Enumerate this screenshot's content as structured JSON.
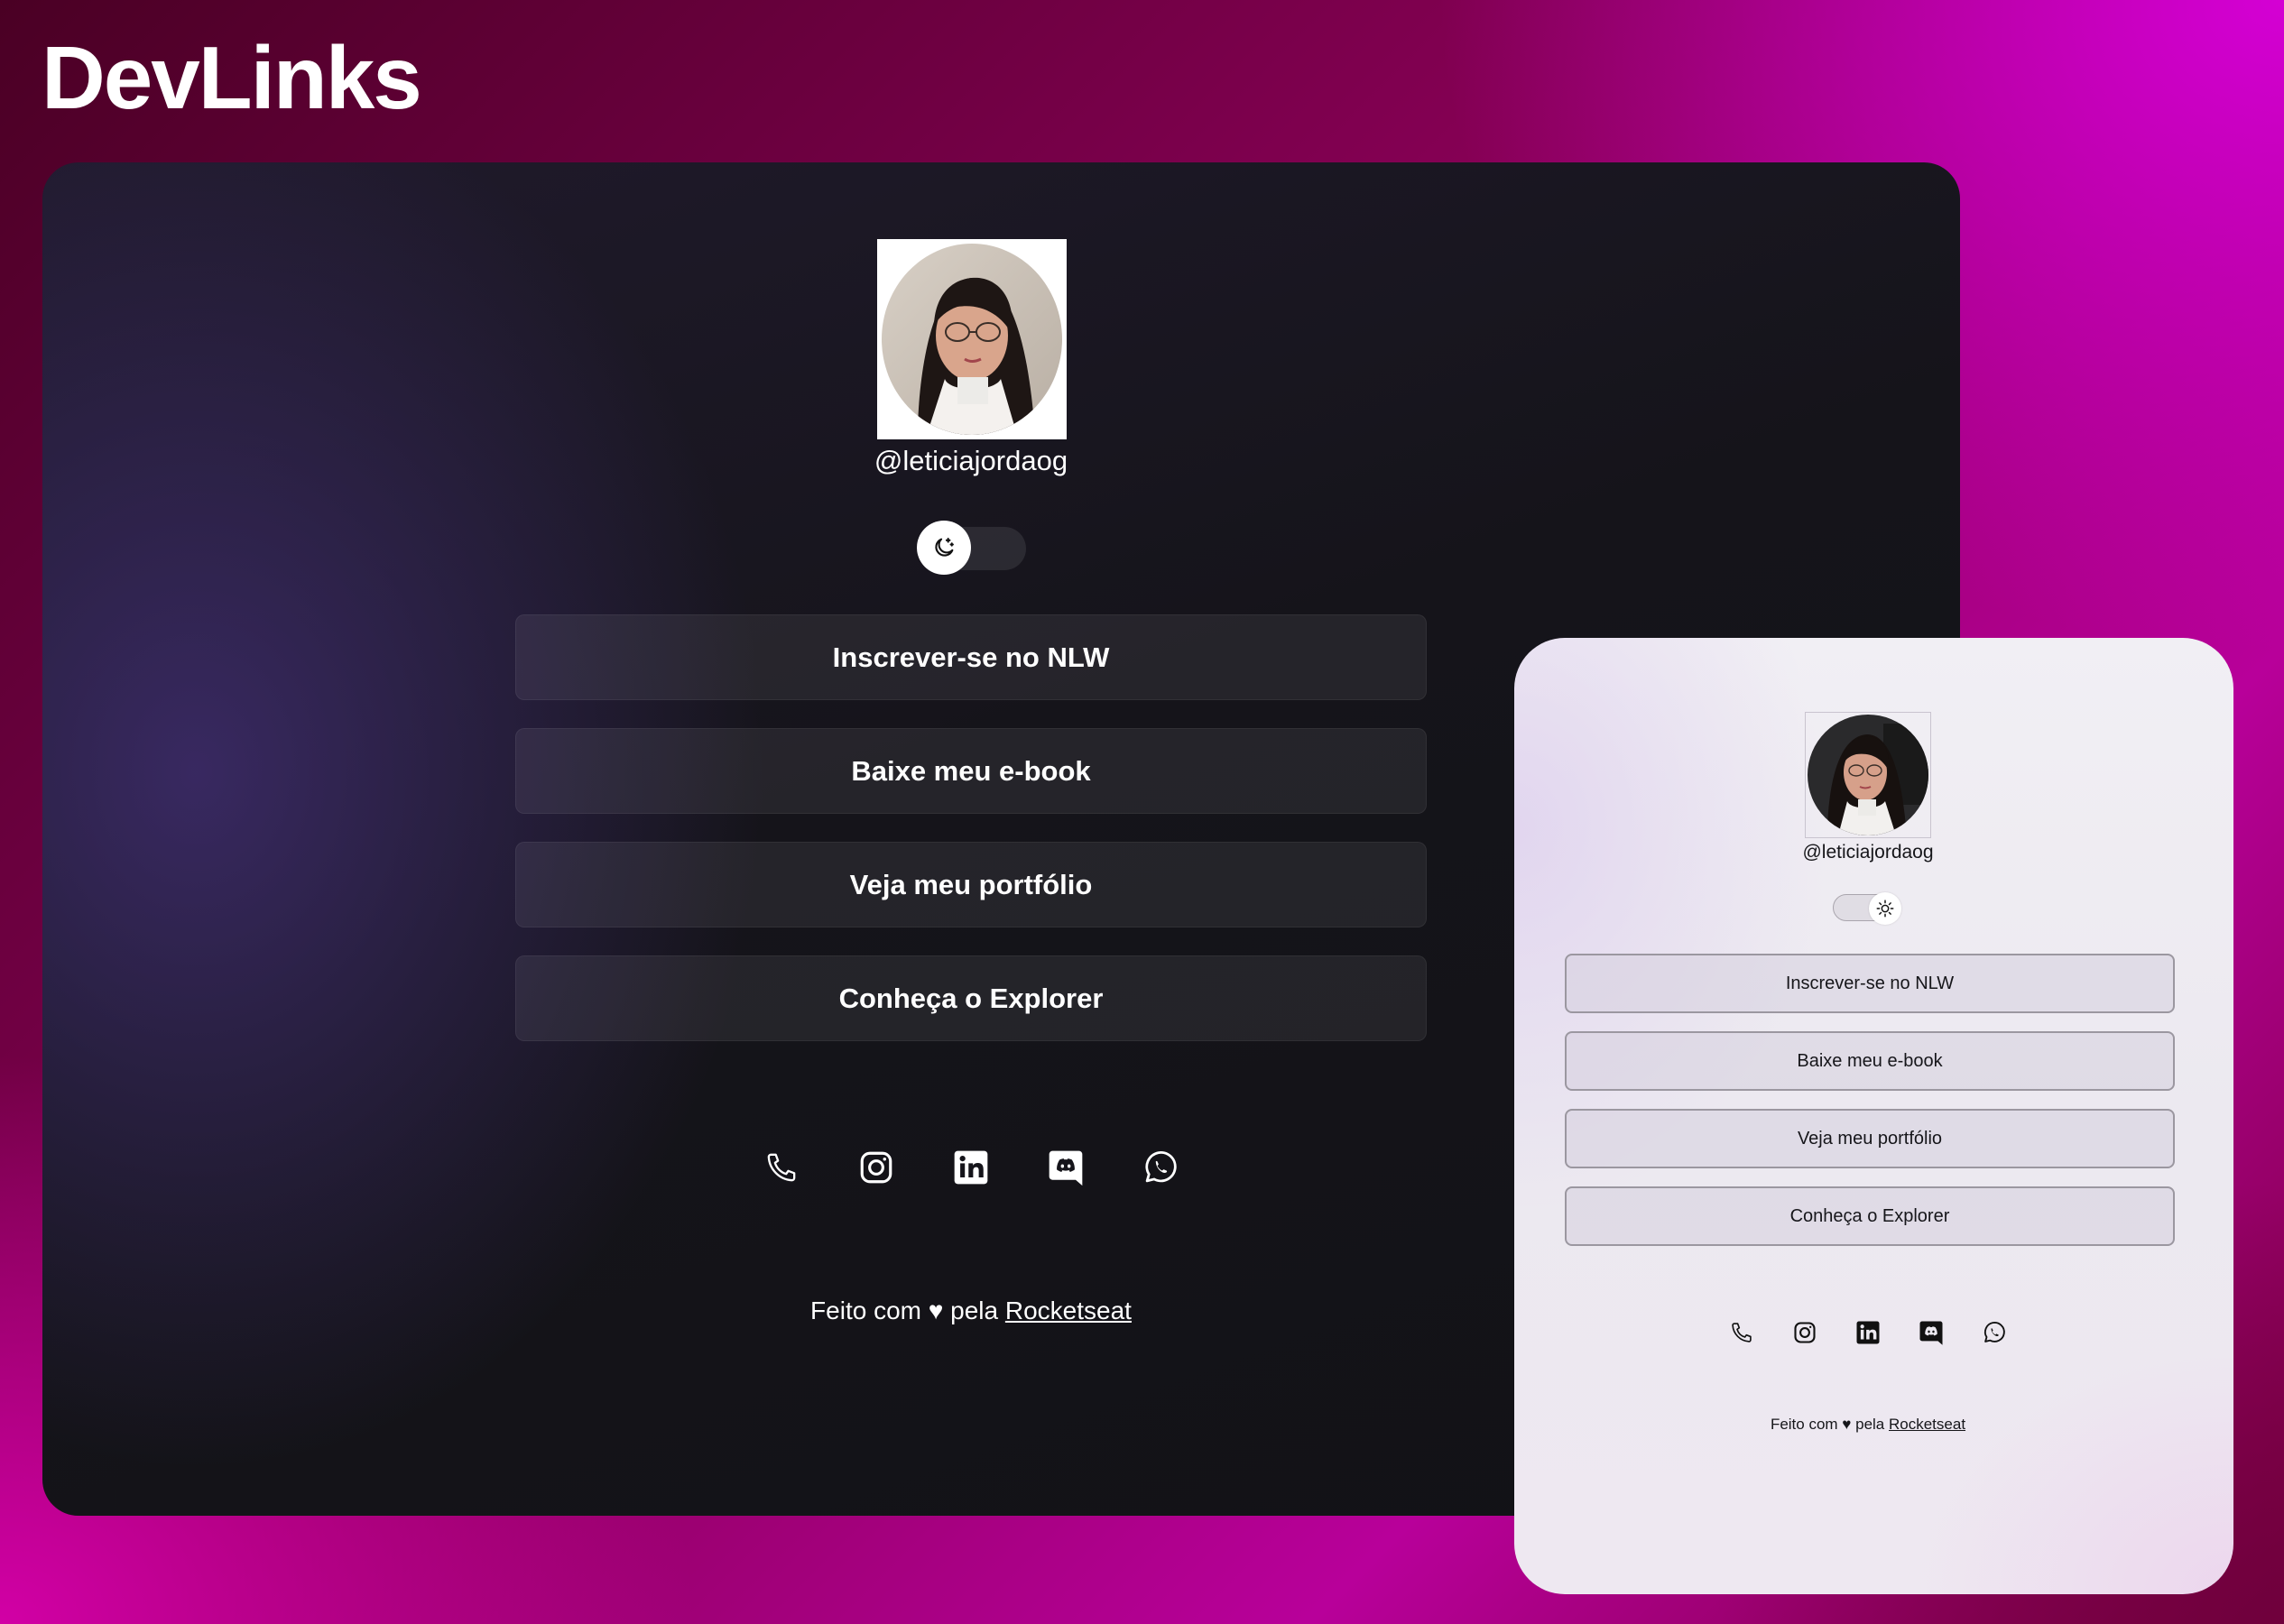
{
  "header": {
    "title": "DevLinks"
  },
  "colors": {
    "dark_card_bg": "#15141a",
    "light_card_bg": "#ece9f0",
    "accent_magenta": "#d400d4",
    "text_light": "#ffffff",
    "text_dark": "#16161a"
  },
  "dark_view": {
    "avatar_alt": "Profile photo",
    "username": "@leticiajordaog",
    "toggle": {
      "mode": "dark",
      "icon": "moon-stars-icon"
    },
    "links": [
      {
        "label": "Inscrever-se no NLW"
      },
      {
        "label": "Baixe meu e-book"
      },
      {
        "label": "Veja meu portfólio"
      },
      {
        "label": "Conheça o Explorer"
      }
    ],
    "social": [
      {
        "name": "phone-icon"
      },
      {
        "name": "instagram-icon"
      },
      {
        "name": "linkedin-icon"
      },
      {
        "name": "discord-icon"
      },
      {
        "name": "whatsapp-icon"
      }
    ],
    "footer": {
      "prefix": "Feito com ♥ pela",
      "link": "Rocketseat"
    }
  },
  "light_view": {
    "avatar_alt": "Profile photo",
    "username": "@leticiajordaog",
    "toggle": {
      "mode": "light",
      "icon": "sun-icon"
    },
    "links": [
      {
        "label": "Inscrever-se no NLW"
      },
      {
        "label": "Baixe meu e-book"
      },
      {
        "label": "Veja meu portfólio"
      },
      {
        "label": "Conheça o Explorer"
      }
    ],
    "social": [
      {
        "name": "phone-icon"
      },
      {
        "name": "instagram-icon"
      },
      {
        "name": "linkedin-icon"
      },
      {
        "name": "discord-icon"
      },
      {
        "name": "whatsapp-icon"
      }
    ],
    "footer": {
      "prefix": "Feito com ♥ pela",
      "link": "Rocketseat"
    }
  }
}
